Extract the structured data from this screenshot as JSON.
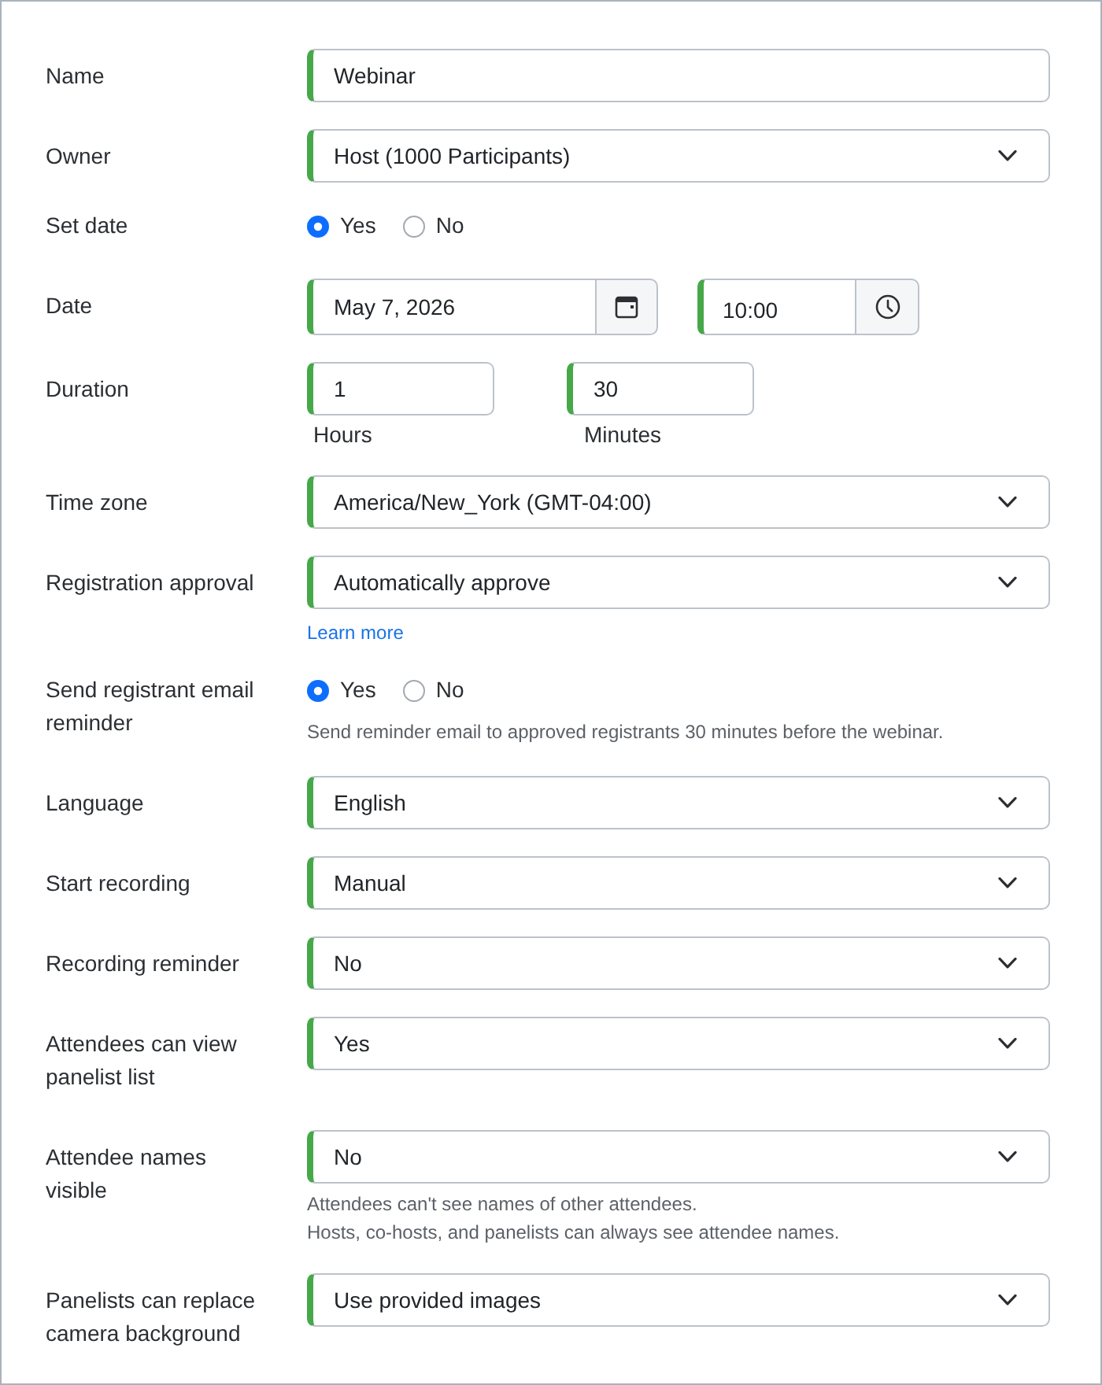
{
  "fields": [
    {
      "kind": "text",
      "label": "Name",
      "value": "Webinar"
    },
    {
      "kind": "select",
      "label": "Owner",
      "value": "Host (1000 Participants)"
    },
    {
      "kind": "radio",
      "label": "Set date",
      "options": [
        {
          "label": "Yes",
          "selected": true
        },
        {
          "label": "No",
          "selected": false
        }
      ]
    },
    {
      "kind": "datetime",
      "label": "Date",
      "date": "May 7, 2026",
      "time": "10:00"
    },
    {
      "kind": "duration",
      "label": "Duration",
      "parts": [
        {
          "value": "1",
          "caption": "Hours"
        },
        {
          "value": "30",
          "caption": "Minutes"
        }
      ]
    },
    {
      "kind": "select",
      "label": "Time zone",
      "value": "America/New_York (GMT-04:00)"
    },
    {
      "kind": "select",
      "label": "Registration approval",
      "value": "Automatically approve",
      "link": "Learn more"
    },
    {
      "kind": "radio",
      "label": "Send registrant email reminder",
      "options": [
        {
          "label": "Yes",
          "selected": true
        },
        {
          "label": "No",
          "selected": false
        }
      ],
      "help": [
        "Send reminder email to approved registrants 30 minutes before the webinar."
      ]
    },
    {
      "kind": "select",
      "label": "Language",
      "value": "English"
    },
    {
      "kind": "select",
      "label": "Start recording",
      "value": "Manual"
    },
    {
      "kind": "select",
      "label": "Recording reminder",
      "value": "No"
    },
    {
      "kind": "select",
      "label": "Attendees can view panelist list",
      "value": "Yes"
    },
    {
      "kind": "select",
      "label": "Attendee names visible",
      "value": "No",
      "help": [
        "Attendees can't see names of other attendees.",
        "Hosts, co-hosts, and panelists can always see attendee names."
      ]
    },
    {
      "kind": "select",
      "label": "Panelists can replace camera background",
      "value": "Use provided images"
    }
  ]
}
